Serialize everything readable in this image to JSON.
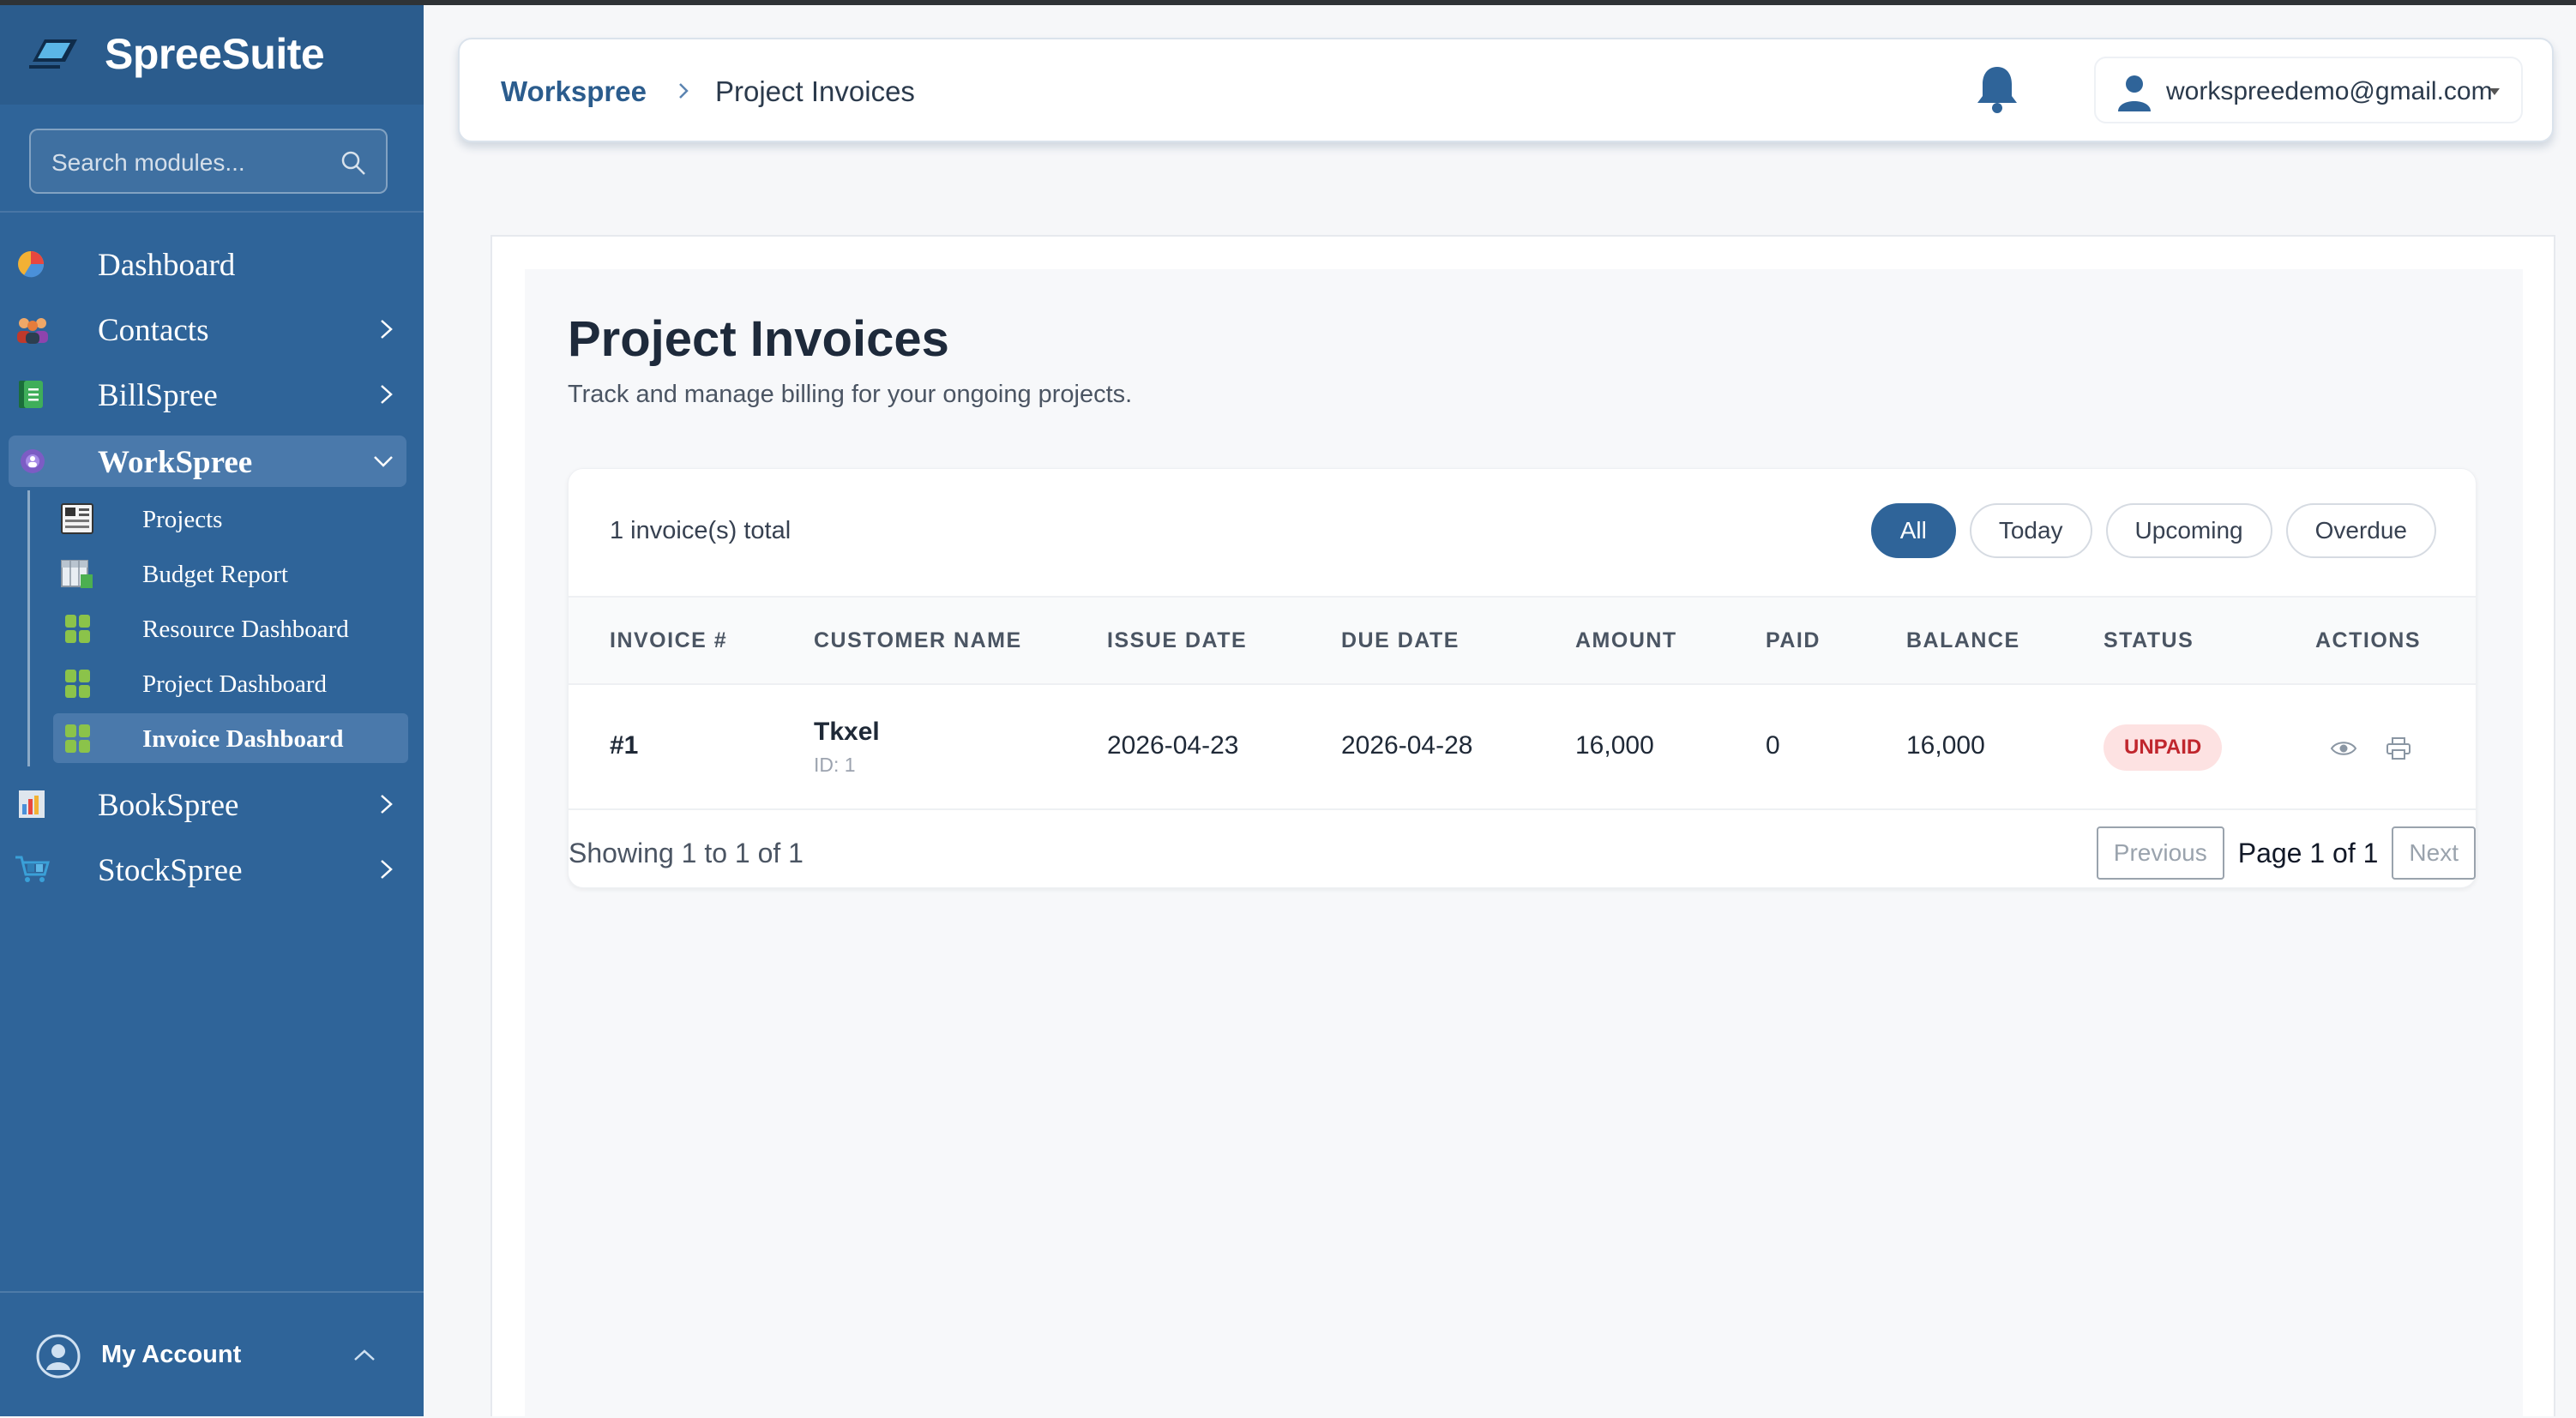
{
  "brand": {
    "name": "SpreeSuite"
  },
  "search": {
    "placeholder": "Search modules..."
  },
  "sidebar": {
    "items": [
      {
        "label": "Dashboard",
        "icon": "pie-chart-icon"
      },
      {
        "label": "Contacts",
        "icon": "people-icon"
      },
      {
        "label": "BillSpree",
        "icon": "document-icon"
      },
      {
        "label": "WorkSpree",
        "icon": "gear-group-icon",
        "expanded": true
      },
      {
        "label": "BookSpree",
        "icon": "ledger-icon"
      },
      {
        "label": "StockSpree",
        "icon": "cart-icon"
      }
    ],
    "workspree_children": [
      {
        "label": "Projects",
        "icon": "clipboard-icon"
      },
      {
        "label": "Budget Report",
        "icon": "spreadsheet-icon"
      },
      {
        "label": "Resource Dashboard",
        "icon": "grid-icon"
      },
      {
        "label": "Project Dashboard",
        "icon": "grid-icon"
      },
      {
        "label": "Invoice Dashboard",
        "icon": "grid-icon",
        "active": true
      }
    ],
    "account": {
      "label": "My Account"
    }
  },
  "header": {
    "breadcrumb_root": "Workspree",
    "breadcrumb_current": "Project Invoices",
    "user_email": "workspreedemo@gmail.com"
  },
  "page": {
    "title": "Project Invoices",
    "subtitle": "Track and manage billing for your ongoing projects."
  },
  "invoices": {
    "count_text": "1 invoice(s) total",
    "filters": [
      "All",
      "Today",
      "Upcoming",
      "Overdue"
    ],
    "active_filter": "All",
    "columns": [
      "INVOICE #",
      "CUSTOMER NAME",
      "ISSUE DATE",
      "DUE DATE",
      "AMOUNT",
      "PAID",
      "BALANCE",
      "STATUS",
      "ACTIONS"
    ],
    "rows": [
      {
        "invoice": "#1",
        "customer": "Tkxel",
        "customer_id": "ID: 1",
        "issue_date": "2026-04-23",
        "due_date": "2026-04-28",
        "amount": "16,000",
        "paid": "0",
        "balance": "16,000",
        "status": "UNPAID"
      }
    ],
    "showing": "Showing 1 to 1 of 1",
    "pagination": {
      "previous": "Previous",
      "info": "Page 1 of 1",
      "next": "Next"
    }
  },
  "colors": {
    "sidebar": "#2f6499",
    "accent": "#2f6499",
    "unpaid_bg": "#fde2e2",
    "unpaid_text": "#c0262d"
  }
}
